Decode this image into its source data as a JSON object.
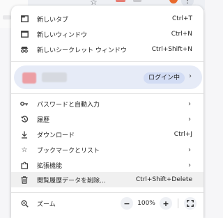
{
  "menu": {
    "new_tab": {
      "label": "新しいタブ",
      "shortcut": "Ctrl+T"
    },
    "new_window": {
      "label": "新しいウィンドウ",
      "shortcut": "Ctrl+N"
    },
    "new_incognito": {
      "label": "新しいシークレット ウィンドウ",
      "shortcut": "Ctrl+Shift+N"
    },
    "profile": {
      "login_label": "ログイン中"
    },
    "passwords": {
      "label": "パスワードと自動入力"
    },
    "history": {
      "label": "履歴"
    },
    "downloads": {
      "label": "ダウンロード",
      "shortcut": "Ctrl+J"
    },
    "bookmarks": {
      "label": "ブックマークとリスト"
    },
    "extensions": {
      "label": "拡張機能"
    },
    "clear_data": {
      "label": "閲覧履歴データを削除...",
      "shortcut": "Ctrl+Shift+Delete"
    },
    "zoom": {
      "label": "ズーム",
      "value": "100%",
      "minus": "−",
      "plus": "+"
    }
  },
  "icons": [
    "tab-icon",
    "window-icon",
    "incognito-icon",
    "key-icon",
    "history-icon",
    "download-icon",
    "star-icon",
    "extension-icon",
    "trash-icon",
    "zoom-icon",
    "fullscreen-icon",
    "chevron-right-icon"
  ],
  "colors": {
    "menu_bg": "#ffffff",
    "profile_bg": "#e6ebf7",
    "login_pill": "#d2dcf4",
    "hover_bg": "#f0f0f0"
  }
}
